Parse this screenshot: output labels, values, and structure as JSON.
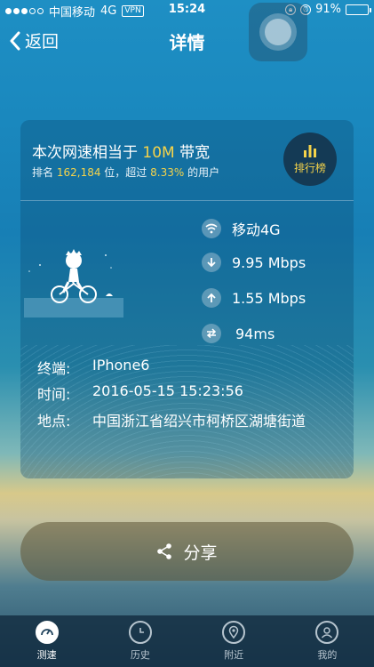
{
  "status_bar": {
    "carrier": "中国移动",
    "network": "4G",
    "vpn": "VPN",
    "time": "15:24",
    "battery": "91%",
    "battery_level": 0.91
  },
  "nav": {
    "back_label": "返回",
    "title": "详情"
  },
  "result": {
    "headline_prefix": "本次网速相当于",
    "bandwidth": "10M",
    "headline_suffix": "带宽",
    "rank_prefix": "排名",
    "rank_value": "162,184",
    "rank_mid": "位，超过",
    "percent": "8.33%",
    "rank_suffix": "的用户",
    "leaderboard_label": "排行榜"
  },
  "metrics": {
    "network": "移动4G",
    "download": "9.95 Mbps",
    "upload": "1.55 Mbps",
    "ping": "94ms"
  },
  "details": [
    {
      "key": "终端:",
      "value": "IPhone6"
    },
    {
      "key": "时间:",
      "value": "2016-05-15 15:23:56"
    },
    {
      "key": "地点:",
      "value": "中国浙江省绍兴市柯桥区湖塘街道"
    }
  ],
  "share_label": "分享",
  "tabs": [
    {
      "label": "测速",
      "icon": "speedometer-icon",
      "active": true
    },
    {
      "label": "历史",
      "icon": "clock-icon",
      "active": false
    },
    {
      "label": "附近",
      "icon": "location-pin-icon",
      "active": false
    },
    {
      "label": "我的",
      "icon": "user-icon",
      "active": false
    }
  ],
  "colors": {
    "highlight": "#f5d34a",
    "battery": "#f4d33a"
  }
}
